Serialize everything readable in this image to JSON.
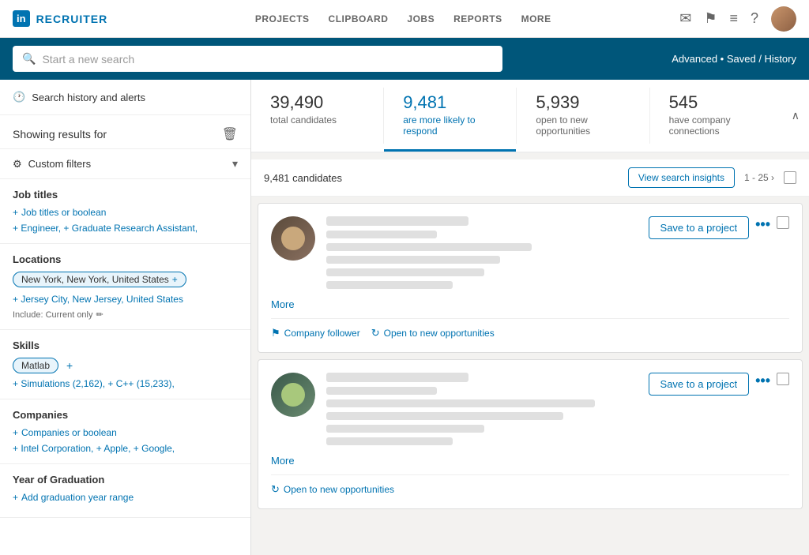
{
  "nav": {
    "logo_text": "in",
    "brand": "RECRUITER",
    "links": [
      "PROJECTS",
      "CLIPBOARD",
      "JOBS",
      "REPORTS",
      "MORE"
    ],
    "icons": [
      "mail",
      "flag",
      "list",
      "help",
      "avatar"
    ]
  },
  "search": {
    "placeholder": "Start a new search",
    "right_text": "Advanced • Saved / History"
  },
  "sidebar": {
    "history_label": "Search history and alerts",
    "showing_results_label": "Showing results for",
    "custom_filters_label": "Custom filters",
    "sections": {
      "job_titles": {
        "title": "Job titles",
        "add_label": "Job titles or boolean",
        "tags": "+ Engineer,  + Graduate Research Assistant,"
      },
      "locations": {
        "title": "Locations",
        "chip": "New York, New York, United States",
        "links": [
          "+ Jersey City, New Jersey, United States"
        ],
        "include_note": "Include: Current only"
      },
      "skills": {
        "title": "Skills",
        "chip": "Matlab",
        "tags": "+ Simulations (2,162),  + C++ (15,233),"
      },
      "companies": {
        "title": "Companies",
        "add_label": "Companies or boolean",
        "tags": "+ Intel Corporation,  + Apple,  + Google,"
      },
      "year_of_graduation": {
        "title": "Year of Graduation",
        "add_label": "Add graduation year range"
      }
    }
  },
  "stats": [
    {
      "number": "39,490",
      "label": "total candidates",
      "active": false
    },
    {
      "number": "9,481",
      "label": "are more likely to respond",
      "active": true
    },
    {
      "number": "5,939",
      "label": "open to new opportunities",
      "active": false
    },
    {
      "number": "545",
      "label": "have company connections",
      "active": false
    }
  ],
  "results": {
    "count": "9,481 candidates",
    "view_insights_btn": "View search insights",
    "pagination": "1 - 25 ›"
  },
  "candidates": [
    {
      "badges": [
        {
          "icon": "flag",
          "label": "Company follower"
        },
        {
          "icon": "open",
          "label": "Open to new opportunities"
        }
      ],
      "more_label": "More",
      "save_label": "Save to a project",
      "skeletons": [
        "s-w1",
        "s-w2",
        "s-w3",
        "s-w4",
        "s-w5",
        "s-w6"
      ]
    },
    {
      "badges": [
        {
          "icon": "open",
          "label": "Open to new opportunities"
        }
      ],
      "more_label": "More",
      "save_label": "Save to a project",
      "skeletons": [
        "s-w1",
        "s-w2",
        "s-w4",
        "s-w3",
        "s-w7",
        "s-w8"
      ]
    }
  ]
}
